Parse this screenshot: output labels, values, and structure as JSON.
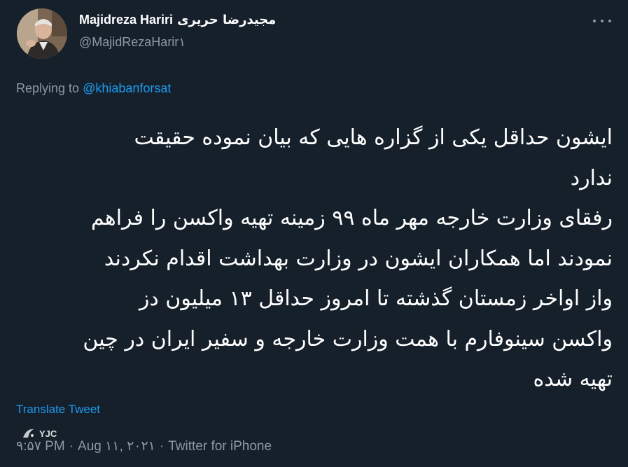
{
  "author": {
    "name": "Majidreza Hariri",
    "name_fa": "مجیدرضا حریری",
    "handle": "@MajidRezaHarir١"
  },
  "more_icon": "more-horizontal-icon",
  "reply": {
    "prefix": "Replying to",
    "to": "@khiabanforsat"
  },
  "body_lines": [
    "ایشون حداقل یکی از گزاره هایی که بیان نموده حقیقت",
    "ندارد",
    "رفقای وزارت خارجه مهر ماه ۹۹ زمینه تهیه واکسن را فراهم",
    "نمودند اما همکاران ایشون در وزارت بهداشت اقدام نکردند",
    "واز اواخر زمستان گذشته تا امروز حداقل ۱۳ میلیون دز",
    "واکسن سینوفارم با همت وزارت خارجه و سفیر ایران در چین",
    "تهیه شده"
  ],
  "translate_label": "Translate Tweet",
  "meta": {
    "time": "۹:۵۷ PM",
    "date": "Aug ۱۱, ۲۰۲۱",
    "source": "Twitter for iPhone",
    "separator": "·"
  },
  "watermark": "YJC",
  "colors": {
    "background": "#15202b",
    "text": "#ffffff",
    "secondary": "#8b98a5",
    "link": "#1d9bf0"
  }
}
